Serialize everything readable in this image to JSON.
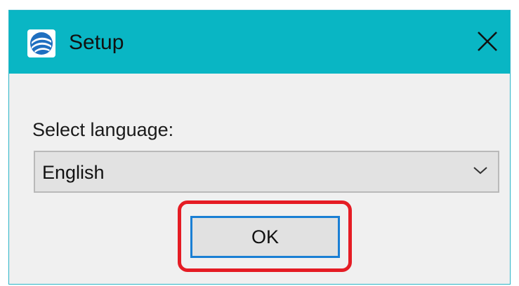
{
  "window": {
    "title": "Setup",
    "titlebar_color": "#09b6c4",
    "app_icon": "setup-app-icon",
    "close_icon": "close-icon"
  },
  "form": {
    "label": "Select language:",
    "language_select": {
      "value": "English",
      "icon": "chevron-down-icon"
    },
    "ok_button": {
      "label": "OK",
      "focused": true,
      "annotation_color": "#e51c24"
    }
  }
}
